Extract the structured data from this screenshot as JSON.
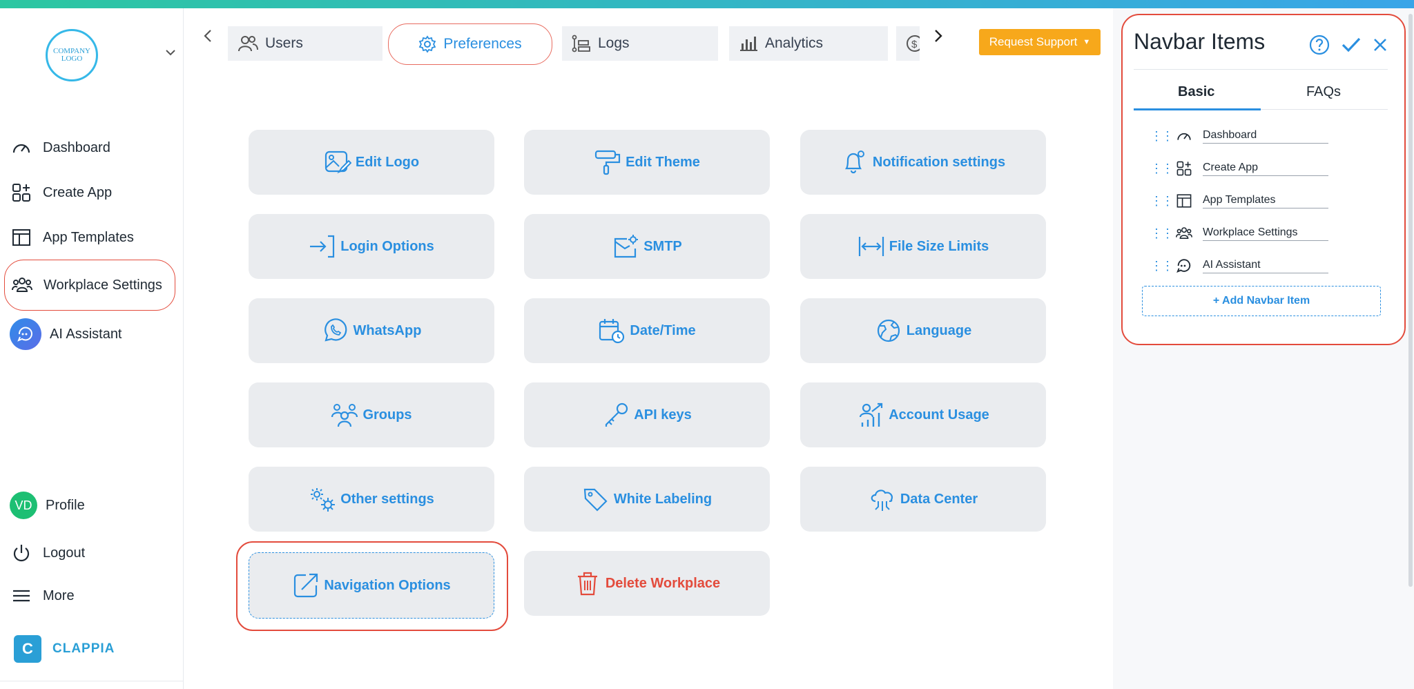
{
  "sidebar": {
    "logo_text": "COMPANY LOGO",
    "items": [
      {
        "label": "Dashboard",
        "icon": "gauge-icon"
      },
      {
        "label": "Create App",
        "icon": "apps-plus-icon"
      },
      {
        "label": "App Templates",
        "icon": "template-icon"
      },
      {
        "label": "Workplace Settings",
        "icon": "users-group-icon"
      },
      {
        "label": "AI Assistant",
        "icon": "ai-chat-icon"
      }
    ],
    "bottom": [
      {
        "label": "Profile",
        "avatar": "VD"
      },
      {
        "label": "Logout",
        "icon": "power-icon"
      },
      {
        "label": "More",
        "icon": "menu-icon"
      }
    ],
    "brand": "CLAPPIA",
    "brand_letter": "C"
  },
  "tabs": [
    {
      "label": "Users",
      "icon": "users-icon"
    },
    {
      "label": "Preferences",
      "icon": "gear-icon",
      "active": true
    },
    {
      "label": "Logs",
      "icon": "logs-icon"
    },
    {
      "label": "Analytics",
      "icon": "bar-chart-icon"
    },
    {
      "label": "",
      "icon": "dollar-icon"
    }
  ],
  "request_support": "Request Support",
  "settings_grid": [
    {
      "label": "Edit Logo",
      "icon": "image-edit-icon"
    },
    {
      "label": "Edit Theme",
      "icon": "paint-roller-icon"
    },
    {
      "label": "Notification settings",
      "icon": "bell-icon"
    },
    {
      "label": "Login Options",
      "icon": "login-icon"
    },
    {
      "label": "SMTP",
      "icon": "mail-gear-icon"
    },
    {
      "label": "File Size Limits",
      "icon": "resize-icon"
    },
    {
      "label": "WhatsApp",
      "icon": "whatsapp-icon"
    },
    {
      "label": "Date/Time",
      "icon": "calendar-clock-icon"
    },
    {
      "label": "Language",
      "icon": "globe-icon"
    },
    {
      "label": "Groups",
      "icon": "group-icon"
    },
    {
      "label": "API keys",
      "icon": "key-icon"
    },
    {
      "label": "Account Usage",
      "icon": "usage-chart-icon"
    },
    {
      "label": "Other settings",
      "icon": "gears-icon"
    },
    {
      "label": "White Labeling",
      "icon": "tag-icon"
    },
    {
      "label": "Data Center",
      "icon": "cloud-network-icon"
    },
    {
      "label": "Navigation Options",
      "icon": "external-link-icon"
    },
    {
      "label": "Delete Workplace",
      "icon": "trash-icon"
    }
  ],
  "panel": {
    "title": "Navbar Items",
    "tabs": [
      "Basic",
      "FAQs"
    ],
    "items": [
      "Dashboard",
      "Create App",
      "App Templates",
      "Workplace Settings",
      "AI Assistant"
    ],
    "add_label": "+ Add Navbar Item"
  },
  "colors": {
    "accent": "#2a8fe0",
    "danger": "#e34b3c",
    "support": "#f7a81b",
    "highlight": "#e34b3c"
  }
}
